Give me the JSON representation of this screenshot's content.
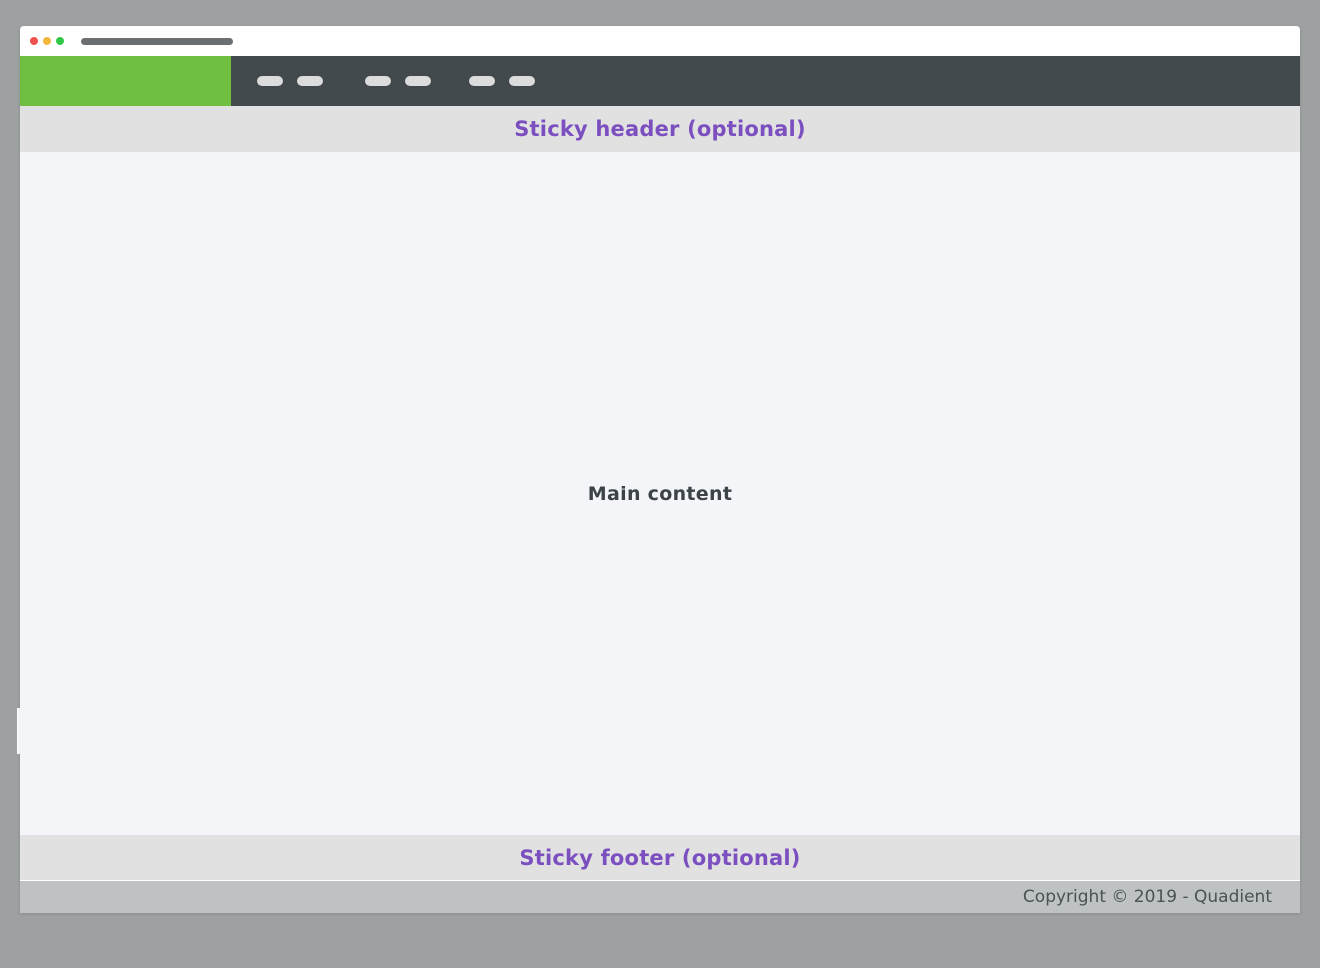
{
  "colors": {
    "page_background": "#9da1a2",
    "window_background": "#f4f5f9",
    "navbar": "#41494d",
    "logo_block": "#6fc041",
    "sticky_band": "#e1e1e2",
    "sticky_text": "#7b4fbf",
    "footer_bar": "#bfc2c3",
    "traffic_red": "#f0524f",
    "traffic_yellow": "#f5b73b",
    "traffic_green": "#33c748"
  },
  "browser": {
    "controls": [
      "close-dot",
      "minimize-dot",
      "maximize-dot"
    ],
    "address_bar_icon": "url-bar-placeholder"
  },
  "navbar": {
    "logo_icon": "logo-placeholder",
    "nav_groups": [
      {
        "items": [
          "nav-placeholder",
          "nav-placeholder"
        ]
      },
      {
        "items": [
          "nav-placeholder",
          "nav-placeholder"
        ]
      },
      {
        "items": [
          "nav-placeholder",
          "nav-placeholder"
        ]
      }
    ]
  },
  "sticky_header": {
    "label": "Sticky header (optional)"
  },
  "main": {
    "label": "Main content"
  },
  "sticky_footer": {
    "label": "Sticky footer (optional)"
  },
  "footer": {
    "copyright": "Copyright © 2019 - Quadient"
  }
}
